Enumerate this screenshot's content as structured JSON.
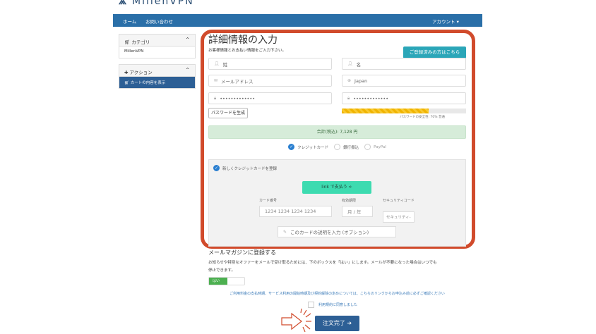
{
  "logo": {
    "text": "MillenVPN"
  },
  "nav": {
    "home": "ホーム",
    "contact": "お問い合わせ",
    "account": "アカウント ▾"
  },
  "sidebar": {
    "category": {
      "title": "カテゴリ",
      "items": [
        "MillenVPN"
      ]
    },
    "actions": {
      "title": "アクション",
      "items": [
        "カートの内容を表示"
      ]
    }
  },
  "form": {
    "title": "詳細情報の入力",
    "subtitle": "お客様情報とお支払い情報をご入力下さい。",
    "registered_button": "ご登録済みの方はこちら",
    "last_name_placeholder": "姓",
    "first_name_placeholder": "名",
    "email_placeholder": "メールアドレス",
    "country": "Japan",
    "password": "•••••••••••••",
    "password_confirm": "•••••••••••••",
    "generate_password": "パスワードを生成",
    "strength_percent": 70,
    "strength_label": "パスワードの安全性: 70% 普通",
    "total": "合計(税込):  7,128 円",
    "payment_methods": [
      "クレジットカード",
      "銀行振込",
      "PayPal"
    ],
    "new_card_label": "新しくクレジットカードを登録",
    "link_button": "link で支払う ➪",
    "card_number_label": "カード番号",
    "card_number_placeholder": "1234 1234 1234 1234",
    "expiry_label": "有効期限",
    "expiry_placeholder": "月 / 年",
    "cvc_label": "セキュリティコード",
    "cvc_placeholder": "セキュリティ-",
    "description_placeholder": "このカードの説明を入力 (オプション)"
  },
  "newsletter": {
    "title": "メールマガジンに登録する",
    "text1": "お知らせや特別なオファーをメールで受け取るためには、下のボックスを「はい」にします。メールが不要になった場合はいつでも",
    "text2": "停止できます。",
    "toggle": "はい"
  },
  "notice": "ご利用料金の支払時期、サービス利用の開始時期及び契約解除の定めについては、こちらのリンクからお申込み前に必ずご確認ください",
  "agree": "利用規約に同意しました",
  "order_button": "注文完了"
}
